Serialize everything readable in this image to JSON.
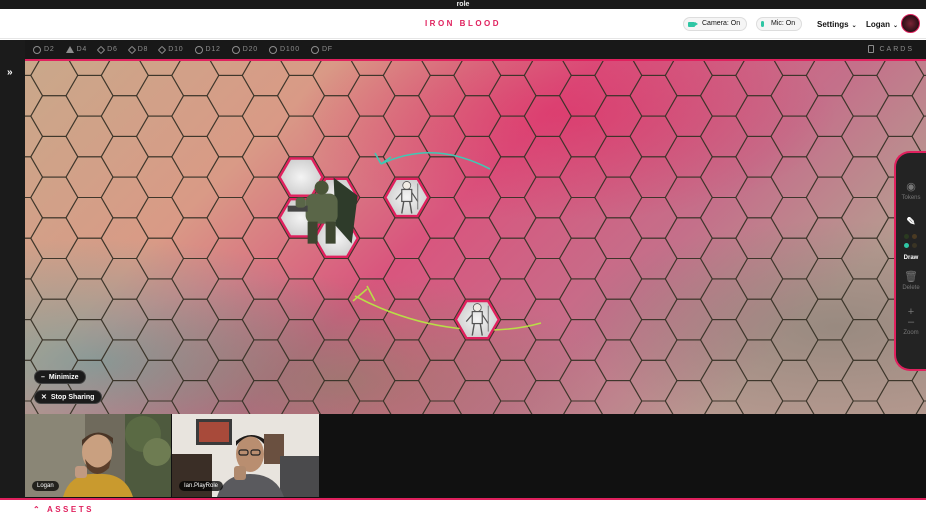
{
  "app": {
    "window_title": "role",
    "campaign_title": "IRON BLOOD"
  },
  "header": {
    "camera_label": "Camera: On",
    "mic_label": "Mic: On",
    "settings_label": "Settings",
    "user_label": "Logan"
  },
  "dice": [
    "D2",
    "D4",
    "D6",
    "D8",
    "D10",
    "D12",
    "D20",
    "D100",
    "DF"
  ],
  "cards_label": "CARDS",
  "map_controls": {
    "minimize_label": "Minimize",
    "stop_sharing_label": "Stop Sharing"
  },
  "toolbar": {
    "tokens_label": "Tokens",
    "draw_label": "Draw",
    "delete_label": "Delete",
    "zoom_label": "Zoom",
    "active_tool": "draw",
    "draw_colors": [
      "#2a3a20",
      "#4a3a22",
      "#2fc6a4",
      "#3a3424"
    ]
  },
  "tokens": [
    {
      "name": "armored-warrior",
      "hex": [
        8,
        4
      ]
    },
    {
      "name": "skeleton-1",
      "hex": [
        11,
        3
      ]
    },
    {
      "name": "skeleton-2",
      "hex": [
        13,
        6
      ]
    }
  ],
  "video_participants": [
    {
      "name": "Logan"
    },
    {
      "name": "Ian.PlayRole"
    }
  ],
  "footer": {
    "assets_label": "ASSETS"
  },
  "colors": {
    "accent": "#e0215e",
    "teal": "#2fc6a4",
    "draw_green": "#b9dd47"
  }
}
